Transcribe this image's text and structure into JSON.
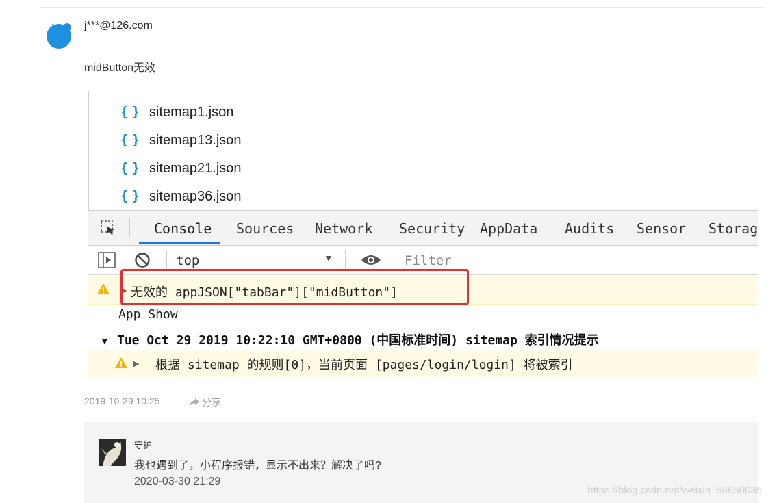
{
  "comment": {
    "user": "j***@126.com",
    "text": "midButton无效",
    "time": "2019-10-29 10:25",
    "share_label": "分享",
    "avatar_color": "#1e8fe1"
  },
  "devtools": {
    "files": [
      "sitemap1.json",
      "sitemap13.json",
      "sitemap21.json",
      "sitemap36.json"
    ],
    "file_icon": "{ }",
    "tabs": [
      "Console",
      "Sources",
      "Network",
      "Security",
      "AppData",
      "Audits",
      "Sensor",
      "Storage"
    ],
    "active_tab": "Console",
    "context": "top",
    "filter_placeholder": "Filter",
    "warning_text": "无效的 appJSON[\"tabBar\"][\"midButton\"]",
    "log_text": "App Show",
    "group_text": "Tue Oct 29 2019 10:22:10 GMT+0800 (中国标准时间) sitemap 索引情况提示",
    "nested_warning_text": "根据 sitemap 的规则[0]，当前页面 [pages/login/login] 将被索引",
    "highlight_color": "#e53030",
    "warning_bg": "#fffbe5",
    "tab_accent": "#1a73e8"
  },
  "reply": {
    "user": "守护",
    "text": "我也遇到了，小程序报错，显示不出来？解决了吗?",
    "time": "2020-03-30 21:29"
  },
  "watermark": "https://blog.csdn.net/weixin_56650035"
}
